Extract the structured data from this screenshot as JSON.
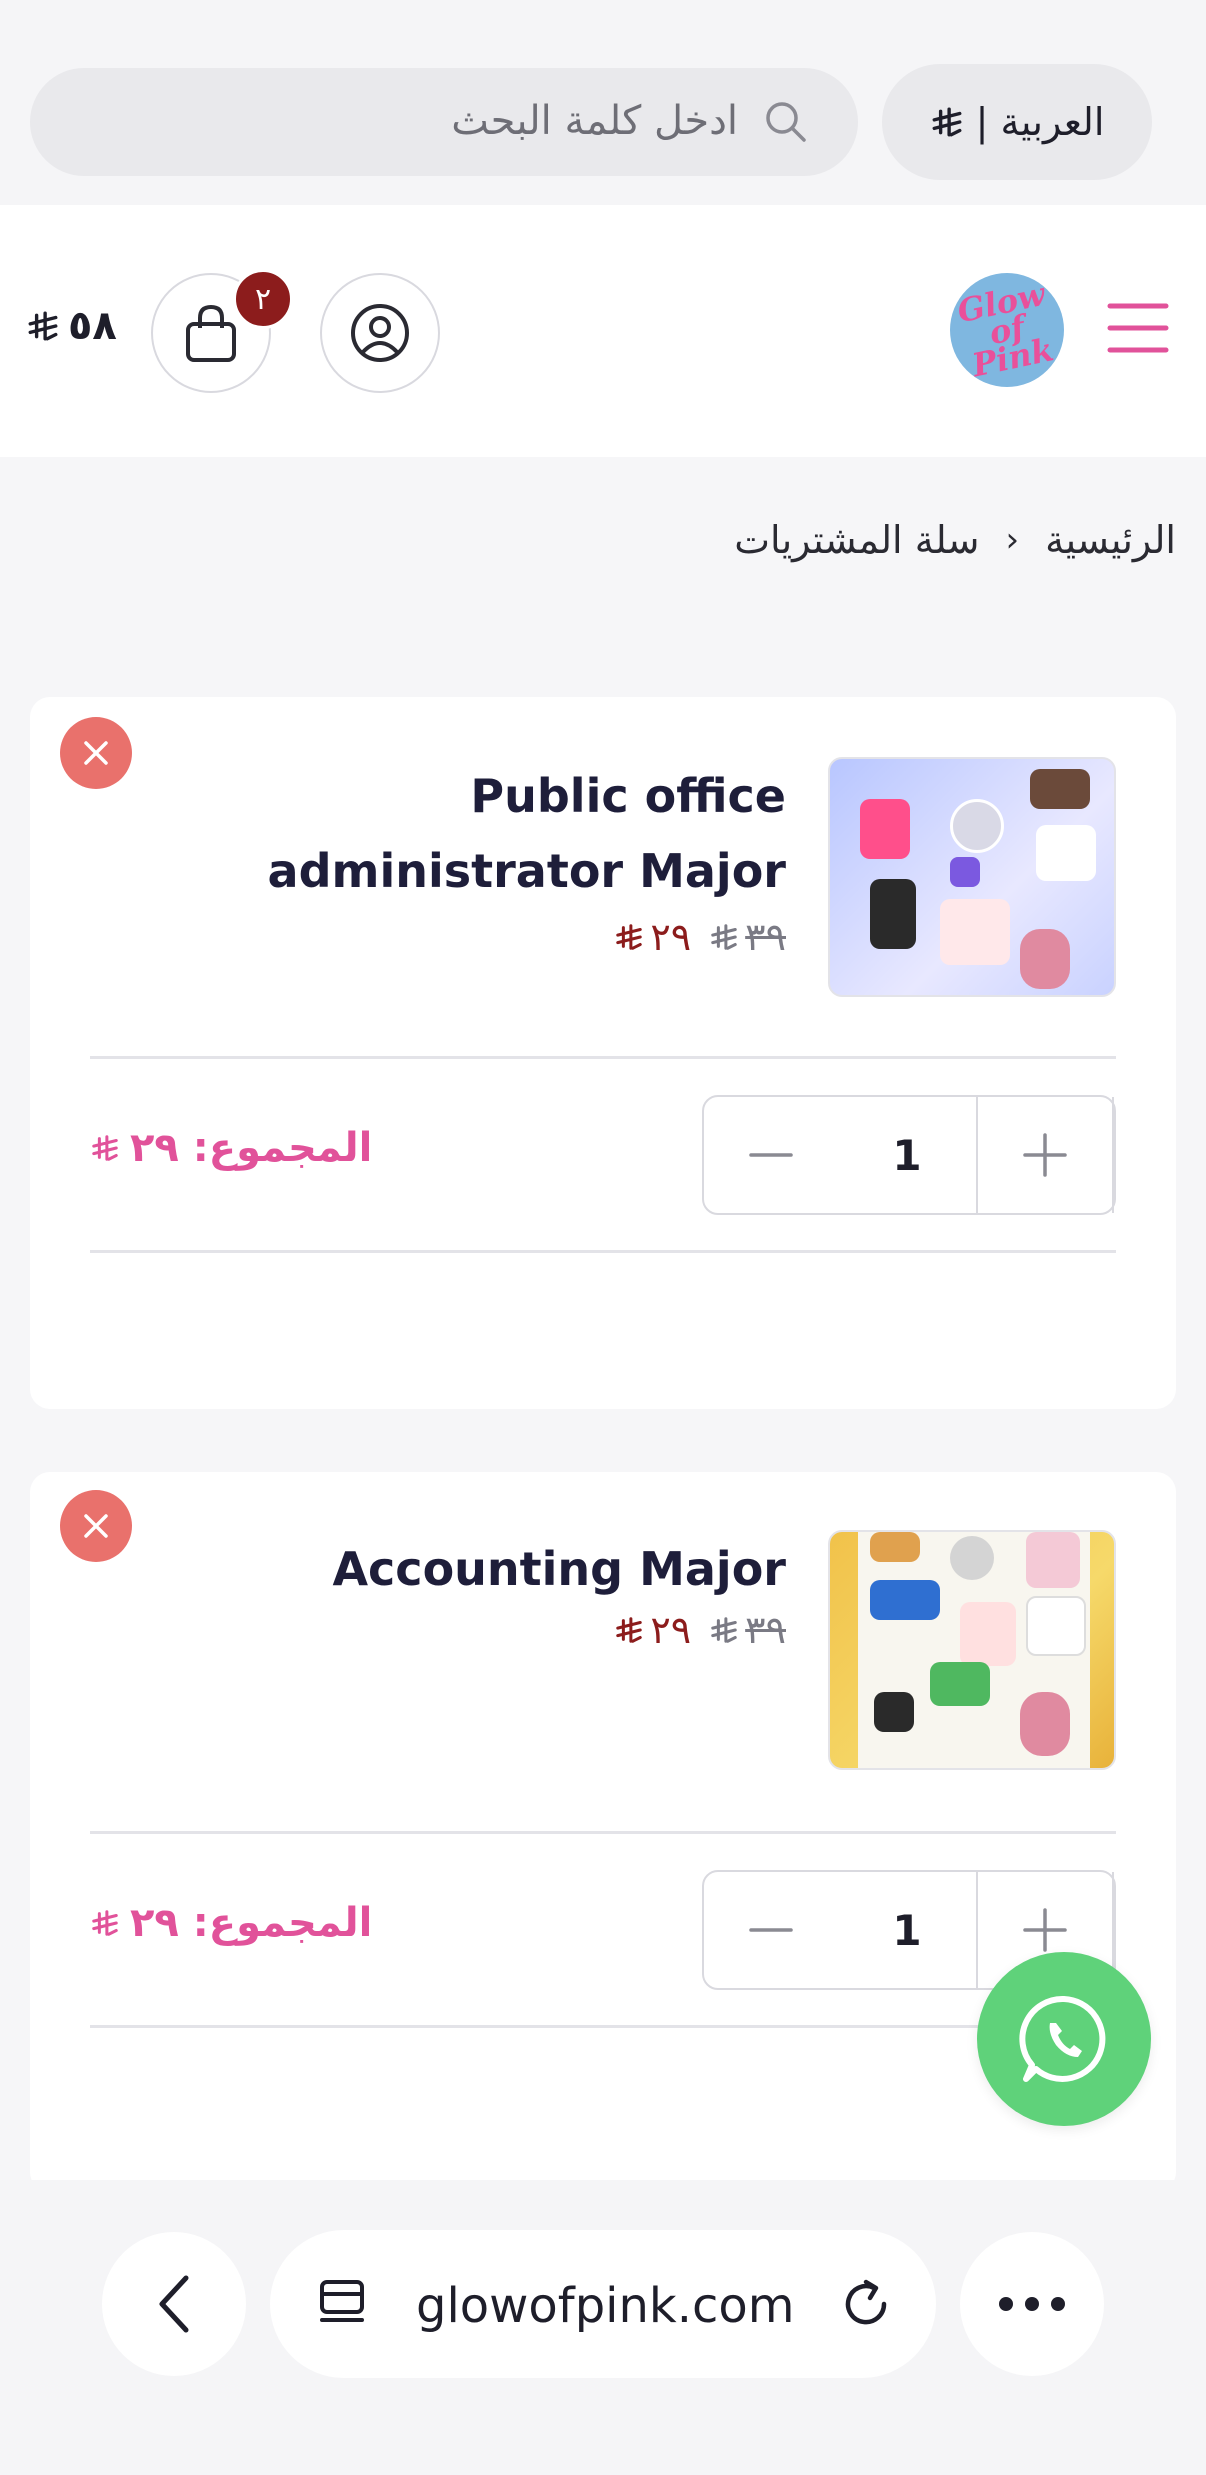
{
  "topbar": {
    "search_placeholder": "ادخل كلمة البحث",
    "language_label": "العربية |"
  },
  "header": {
    "cart_count": "٢",
    "cart_total": "٥٨",
    "logo_text": "Glow of Pink"
  },
  "breadcrumb": {
    "home": "الرئيسية",
    "separator": "‹",
    "current": "سلة المشتريات"
  },
  "cart_items": [
    {
      "title": "Public office administrator Major",
      "old_price": "٣٩",
      "new_price": "٢٩",
      "quantity": "1",
      "total_label": "المجموع: ٢٩"
    },
    {
      "title": "Accounting Major",
      "old_price": "٣٩",
      "new_price": "٢٩",
      "quantity": "1",
      "total_label": "المجموع: ٢٩"
    }
  ],
  "browser": {
    "url": "glowofpink.com"
  },
  "colors": {
    "accent_pink": "#e1529a",
    "price_red": "#8c1c1c",
    "remove_red": "#e9716c",
    "whatsapp_green": "#5fd27a"
  }
}
